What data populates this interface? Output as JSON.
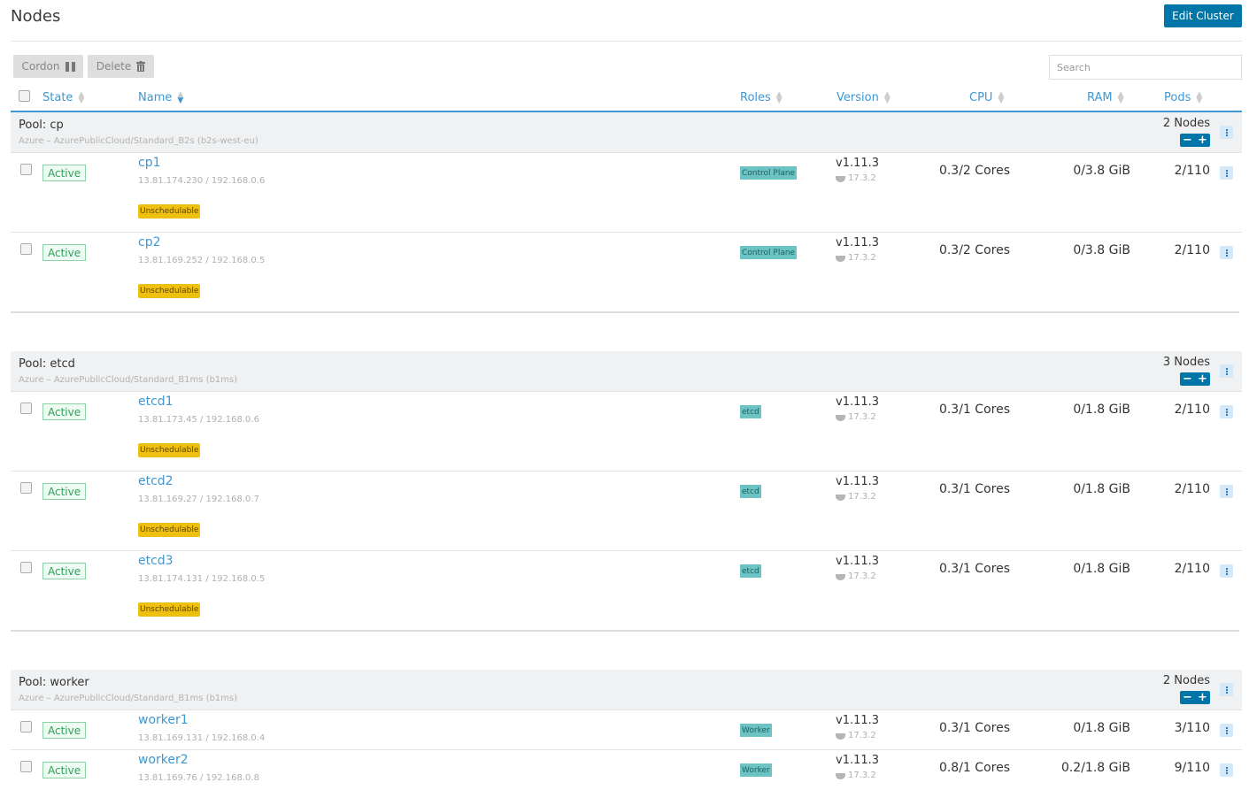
{
  "header": {
    "title": "Nodes",
    "edit_cluster": "Edit Cluster"
  },
  "toolbar": {
    "cordon": "Cordon",
    "delete": "Delete",
    "search_placeholder": "Search"
  },
  "columns": {
    "state": "State",
    "name": "Name",
    "roles": "Roles",
    "version": "Version",
    "cpu": "CPU",
    "ram": "RAM",
    "pods": "Pods"
  },
  "pools": [
    {
      "name": "Pool: cp",
      "sub": "Azure – AzurePublicCloud/Standard_B2s (b2s-west-eu)",
      "count": "2 Nodes",
      "nodes": [
        {
          "state": "Active",
          "name": "cp1",
          "ips": "13.81.174.230   /   192.168.0.6",
          "unsched": "Unschedulable",
          "role": "Control Plane",
          "version": "v1.11.3",
          "docker": "17.3.2",
          "cpu": "0.3/2 Cores",
          "ram": "0/3.8 GiB",
          "pods": "2/110"
        },
        {
          "state": "Active",
          "name": "cp2",
          "ips": "13.81.169.252   /   192.168.0.5",
          "unsched": "Unschedulable",
          "role": "Control Plane",
          "version": "v1.11.3",
          "docker": "17.3.2",
          "cpu": "0.3/2 Cores",
          "ram": "0/3.8 GiB",
          "pods": "2/110"
        }
      ]
    },
    {
      "name": "Pool: etcd",
      "sub": "Azure – AzurePublicCloud/Standard_B1ms (b1ms)",
      "count": "3 Nodes",
      "nodes": [
        {
          "state": "Active",
          "name": "etcd1",
          "ips": "13.81.173.45   /   192.168.0.6",
          "unsched": "Unschedulable",
          "role": "etcd",
          "version": "v1.11.3",
          "docker": "17.3.2",
          "cpu": "0.3/1 Cores",
          "ram": "0/1.8 GiB",
          "pods": "2/110"
        },
        {
          "state": "Active",
          "name": "etcd2",
          "ips": "13.81.169.27   /   192.168.0.7",
          "unsched": "Unschedulable",
          "role": "etcd",
          "version": "v1.11.3",
          "docker": "17.3.2",
          "cpu": "0.3/1 Cores",
          "ram": "0/1.8 GiB",
          "pods": "2/110"
        },
        {
          "state": "Active",
          "name": "etcd3",
          "ips": "13.81.174.131   /   192.168.0.5",
          "unsched": "Unschedulable",
          "role": "etcd",
          "version": "v1.11.3",
          "docker": "17.3.2",
          "cpu": "0.3/1 Cores",
          "ram": "0/1.8 GiB",
          "pods": "2/110"
        }
      ]
    },
    {
      "name": "Pool: worker",
      "sub": "Azure – AzurePublicCloud/Standard_B1ms (b1ms)",
      "count": "2 Nodes",
      "nodes": [
        {
          "state": "Active",
          "name": "worker1",
          "ips": "13.81.169.131   /   192.168.0.4",
          "role": "Worker",
          "version": "v1.11.3",
          "docker": "17.3.2",
          "cpu": "0.3/1 Cores",
          "ram": "0/1.8 GiB",
          "pods": "3/110"
        },
        {
          "state": "Active",
          "name": "worker2",
          "ips": "13.81.169.76   /   192.168.0.8",
          "role": "Worker",
          "version": "v1.11.3",
          "docker": "17.3.2",
          "cpu": "0.8/1 Cores",
          "ram": "0.2/1.8 GiB",
          "pods": "9/110"
        }
      ]
    }
  ]
}
